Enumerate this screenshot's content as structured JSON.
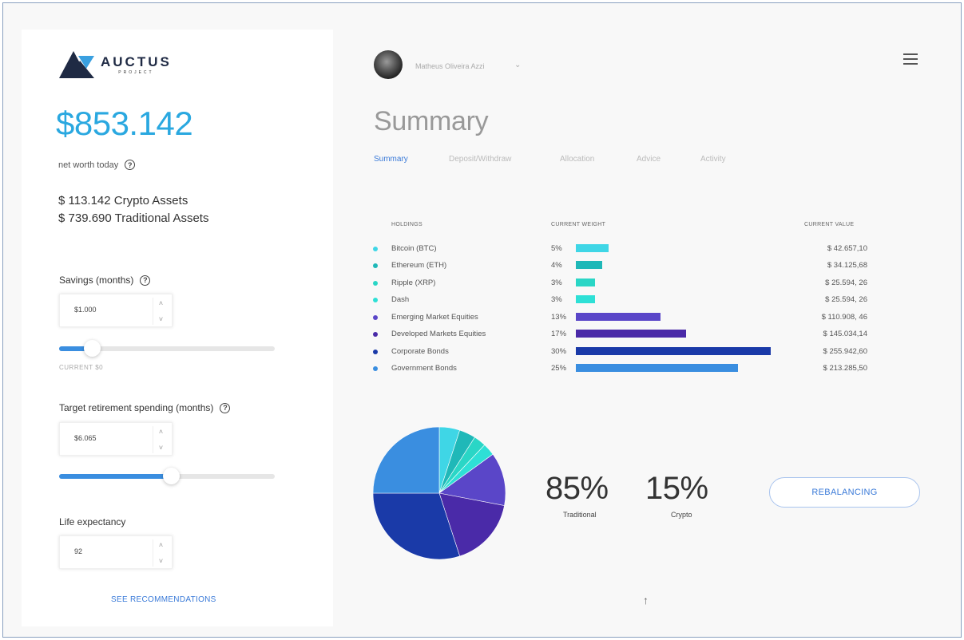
{
  "brand": {
    "name": "AUCTUS",
    "sub": "PROJECT"
  },
  "sidebar": {
    "net_worth": "$853.142",
    "net_worth_label": "net worth today",
    "crypto_assets": "$ 113.142 Crypto Assets",
    "traditional_assets": "$ 739.690 Traditional Assets",
    "savings": {
      "label": "Savings (months)",
      "value": "$1.000",
      "slider_fraction": 0.15,
      "caption": "CURRENT $0"
    },
    "retirement": {
      "label": "Target retirement spending (months)",
      "value": "$6.065",
      "slider_fraction": 0.52
    },
    "life_expectancy": {
      "label": "Life expectancy",
      "value": "92"
    },
    "see_recommendations": "SEE RECOMMENDATIONS"
  },
  "header": {
    "user_name": "Matheus Oliveira Azzi",
    "chevron": "⌄"
  },
  "page_title": "Summary",
  "tabs": [
    {
      "label": "Summary",
      "active": true
    },
    {
      "label": "Deposit/Withdraw",
      "active": false
    },
    {
      "label": "Allocation",
      "active": false
    },
    {
      "label": "Advice",
      "active": false
    },
    {
      "label": "Activity",
      "active": false
    }
  ],
  "holdings": {
    "headers": {
      "holdings": "HOLDINGS",
      "weight": "CURRENT WEIGHT",
      "value": "CURRENT VALUE"
    },
    "rows": [
      {
        "name": "Bitcoin (BTC)",
        "weight": "5%",
        "weight_value": 5,
        "value": "$ 42.657,10",
        "color": "#3fd6e6"
      },
      {
        "name": "Ethereum (ETH)",
        "weight": "4%",
        "weight_value": 4,
        "value": "$ 34.125,68",
        "color": "#1fb8b8"
      },
      {
        "name": "Ripple (XRP)",
        "weight": "3%",
        "weight_value": 3,
        "value": "$ 25.594, 26",
        "color": "#2ad6c6"
      },
      {
        "name": "Dash",
        "weight": "3%",
        "weight_value": 3,
        "value": "$ 25.594, 26",
        "color": "#2ee0d6"
      },
      {
        "name": "Emerging Market Equities",
        "weight": "13%",
        "weight_value": 13,
        "value": "$ 110.908, 46",
        "color": "#5a46c8"
      },
      {
        "name": "Developed Markets Equities",
        "weight": "17%",
        "weight_value": 17,
        "value": "$ 145.034,14",
        "color": "#4a2aa8"
      },
      {
        "name": "Corporate Bonds",
        "weight": "30%",
        "weight_value": 30,
        "value": "$ 255.942,60",
        "color": "#1a3aa8"
      },
      {
        "name": "Government Bonds",
        "weight": "25%",
        "weight_value": 25,
        "value": "$ 213.285,50",
        "color": "#3a8ee0"
      }
    ]
  },
  "split": {
    "traditional_pct": "85%",
    "traditional_label": "Traditional",
    "crypto_pct": "15%",
    "crypto_label": "Crypto"
  },
  "rebalancing": "REBALANCING",
  "up_arrow": "↑"
}
